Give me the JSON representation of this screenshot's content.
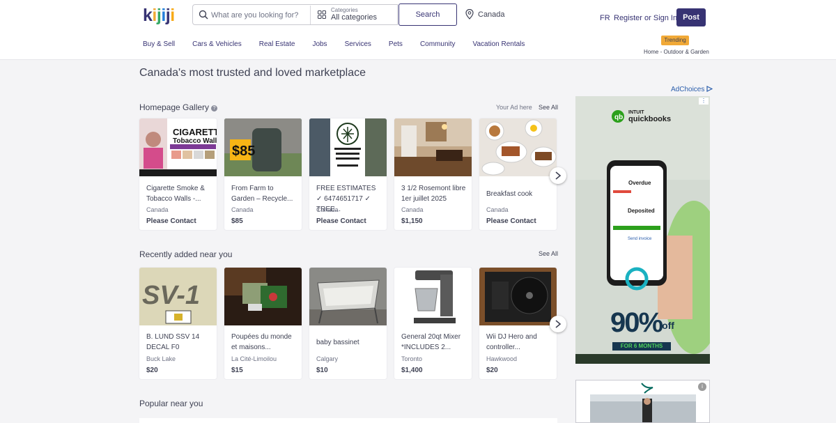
{
  "header": {
    "logo": "kijiji",
    "search_placeholder": "What are you looking for?",
    "categories_label": "Categories",
    "categories_value": "All categories",
    "search_button": "Search",
    "location": "Canada",
    "lang": "FR",
    "register": "Register or Sign In",
    "post_button": "Post"
  },
  "nav": {
    "items": [
      "Buy & Sell",
      "Cars & Vehicles",
      "Real Estate",
      "Jobs",
      "Services",
      "Pets",
      "Community",
      "Vacation Rentals"
    ],
    "trending_badge": "Trending",
    "trending_crumb": "Home - Outdoor & Garden"
  },
  "main": {
    "headline": "Canada's most trusted and loved marketplace",
    "adchoices": "AdChoices",
    "gallery": {
      "title": "Homepage Gallery",
      "your_ad": "Your Ad here",
      "see_all": "See All",
      "cards": [
        {
          "title": "Cigarette Smoke & Tobacco Walls -...",
          "location": "Canada",
          "price": "Please Contact",
          "img": "smoke"
        },
        {
          "title": "From Farm to Garden – Recycle...",
          "location": "Canada",
          "price": "$85",
          "img": "barrel"
        },
        {
          "title": "FREE ESTIMATES ✓ 6474651717 ✓ TREE...",
          "location": "Canada",
          "price": "Please Contact",
          "img": "tree"
        },
        {
          "title": "3 1/2 Rosemont libre 1er juillet 2025",
          "location": "Canada",
          "price": "$1,150",
          "img": "room"
        },
        {
          "title": "Breakfast cook",
          "location": "Canada",
          "price": "Please Contact",
          "img": "food"
        }
      ]
    },
    "recent": {
      "title": "Recently added near you",
      "see_all": "See All",
      "cards": [
        {
          "title": "B. LUND SSV 14 DECAL F0",
          "location": "Buck Lake",
          "price": "$20",
          "img": "decal"
        },
        {
          "title": "Poupées du monde et maisons...",
          "location": "La Cité-Limoilou",
          "price": "$15",
          "img": "dolls"
        },
        {
          "title": "baby bassinet",
          "location": "Calgary",
          "price": "$10",
          "img": "bassinet"
        },
        {
          "title": "General 20qt Mixer *INCLUDES 2...",
          "location": "Toronto",
          "price": "$1,400",
          "img": "mixer"
        },
        {
          "title": "Wii DJ Hero and controller...",
          "location": "Hawkwood",
          "price": "$20",
          "img": "dj"
        }
      ]
    },
    "popular": {
      "title": "Popular near you"
    }
  },
  "ads": {
    "qb_brand_top": "INTUIT",
    "qb_brand": "quickbooks",
    "qb_overdue": "Overdue",
    "qb_deposited": "Deposited",
    "qb_send": "Send invoice",
    "qb_offer_big": "90%",
    "qb_offer_off": "off",
    "qb_offer_sub": "FOR 6 MONTHS"
  },
  "colors": {
    "brand_navy": "#373373",
    "trending": "#f1a937",
    "adchoices": "#2a5dab"
  }
}
